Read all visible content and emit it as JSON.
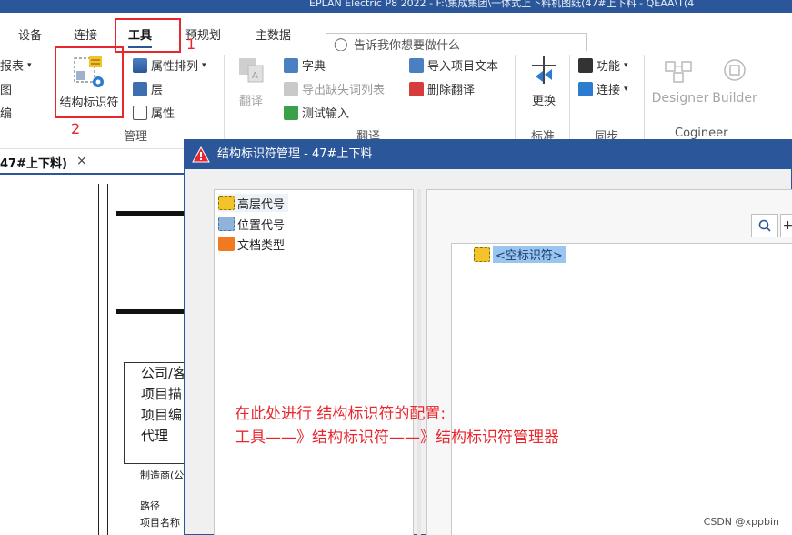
{
  "window": {
    "title_fragment": "EPLAN Electric P8 2022 - F:\\集成集团\\一体式上下料机图纸(47#上下料 - QEAA\\T(4"
  },
  "ribbon_tabs": [
    "设备",
    "连接",
    "工具",
    "预规划",
    "主数据"
  ],
  "active_tab": "工具",
  "search": {
    "placeholder": "告诉我你想要做什么"
  },
  "ribbon": {
    "left_cut": [
      "报表",
      "图",
      "编"
    ],
    "struct_button": "结构标识符",
    "prop_sort": "属性排列",
    "layer": "层",
    "property": "属性",
    "group_manage": "管理",
    "translate": "翻译",
    "dictionary": "字典",
    "export_missing": "导出缺失词列表",
    "test_input": "测试输入",
    "group_translate": "翻译",
    "import_text": "导入项目文本",
    "delete_translation": "删除翻译",
    "replace": "更换",
    "group_standard": "标准",
    "function": "功能",
    "connection": "连接",
    "group_sync": "同步",
    "designer": "Designer",
    "builder": "Builder",
    "group_cogineer": "Cogineer"
  },
  "markers": {
    "one": "1",
    "two": "2"
  },
  "doc_tab": {
    "label": "47#上下料)",
    "close": "×"
  },
  "title_block": [
    "公司/客",
    "项目描",
    "项目编",
    "代理"
  ],
  "title_block_small": [
    "制造商(公",
    "路径",
    "项目名称"
  ],
  "dialog": {
    "title": "结构标识符管理 - 47#上下料",
    "tree": [
      "高层代号",
      "位置代号",
      "文档类型"
    ],
    "empty_node": "<空标识符>"
  },
  "annotation": {
    "line1": "在此处进行 结构标识符的配置:",
    "line2": "工具——》结构标识符——》结构标识符管理器"
  },
  "watermark": "CSDN @xppbin",
  "colors": {
    "accent": "#2b579a",
    "annotation": "#e8262d"
  }
}
